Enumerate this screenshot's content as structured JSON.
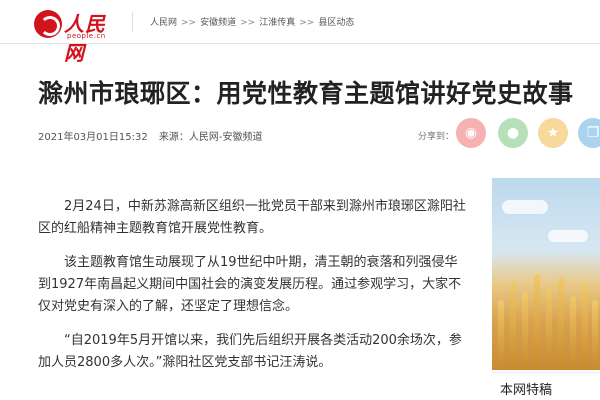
{
  "header": {
    "logo_text": "人民网",
    "logo_sub": "people.cn",
    "breadcrumb": [
      "人民网",
      "安徽频道",
      "江淮传真",
      "县区动态"
    ],
    "separator": ">>"
  },
  "article": {
    "title": "滁州市琅琊区：用党性教育主题馆讲好党史故事",
    "date": "2021年03月01日15:32",
    "source": "来源：人民网-安徽频道",
    "paragraphs": [
      "2月24日，中新苏滁高新区组织一批党员干部来到滁州市琅琊区滁阳社区的红船精神主题教育馆开展党性教育。",
      "该主题教育馆生动展现了从19世纪中叶期，清王朝的衰落和列强侵华到1927年南昌起义期间中国社会的演变发展历程。通过参观学习，大家不仅对党史有深入的了解，还坚定了理想信念。",
      "“自2019年5月开馆以来，我们先后组织开展各类活动200余场次，参加人员2800多人次。”滁阳社区党支部书记汪涛说。"
    ]
  },
  "share": {
    "label": "分享到：",
    "buttons": [
      {
        "name": "weibo",
        "glyph": "◉",
        "color": "#f6b1b1"
      },
      {
        "name": "wechat",
        "glyph": "●",
        "color": "#b7e0ba"
      },
      {
        "name": "qzone",
        "glyph": "★",
        "color": "#f6d99b"
      },
      {
        "name": "copy",
        "glyph": "❐",
        "color": "#a9d3ee"
      }
    ]
  },
  "sidebar": {
    "section_title": "本网特稿"
  }
}
